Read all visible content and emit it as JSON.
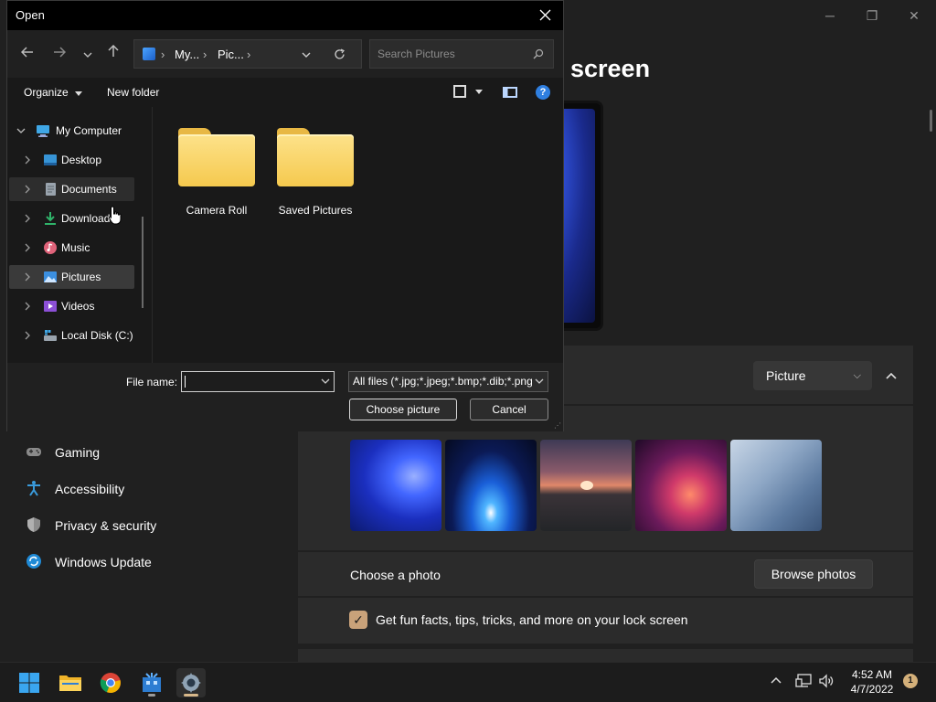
{
  "settings": {
    "heading": "screen",
    "window_controls": {
      "minimize": "─",
      "maximize": "❐",
      "close": "✕"
    },
    "personalize": {
      "select_value": "Picture"
    },
    "choose_photo": {
      "label": "Choose a photo",
      "browse_button": "Browse photos"
    },
    "fun_facts": {
      "label": "Get fun facts, tips, tricks, and more on your lock screen",
      "checked": true
    },
    "sidebar": {
      "items": [
        {
          "label": "Gaming",
          "icon": "gamepad-icon"
        },
        {
          "label": "Accessibility",
          "icon": "accessibility-icon"
        },
        {
          "label": "Privacy & security",
          "icon": "shield-icon"
        },
        {
          "label": "Windows Update",
          "icon": "windows-update-icon"
        }
      ]
    }
  },
  "dialog": {
    "title": "Open",
    "address": {
      "crumb_1": "My...",
      "crumb_2": "Pic...",
      "separator": "›"
    },
    "search_placeholder": "Search Pictures",
    "toolbar": {
      "organize": "Organize",
      "new_folder": "New folder",
      "help": "?"
    },
    "tree": [
      {
        "label": "My Computer",
        "icon": "computer-icon"
      },
      {
        "label": "Desktop",
        "icon": "desktop-icon"
      },
      {
        "label": "Documents",
        "icon": "documents-icon"
      },
      {
        "label": "Downloads",
        "icon": "downloads-icon"
      },
      {
        "label": "Music",
        "icon": "music-icon"
      },
      {
        "label": "Pictures",
        "icon": "pictures-icon"
      },
      {
        "label": "Videos",
        "icon": "videos-icon"
      },
      {
        "label": "Local Disk (C:)",
        "icon": "disk-icon"
      }
    ],
    "folders": [
      {
        "label": "Camera Roll"
      },
      {
        "label": "Saved Pictures"
      }
    ],
    "file_name_label": "File name:",
    "file_name_value": "",
    "filter_value": "All files (*.jpg;*.jpeg;*.bmp;*.dib;*.png",
    "choose_button": "Choose picture",
    "cancel_button": "Cancel"
  },
  "taskbar": {
    "apps": [
      "start-icon",
      "file-explorer-icon",
      "chrome-icon",
      "app-icon",
      "settings-icon"
    ],
    "time": "4:52 AM",
    "date": "4/7/2022",
    "notification_count": "1"
  }
}
